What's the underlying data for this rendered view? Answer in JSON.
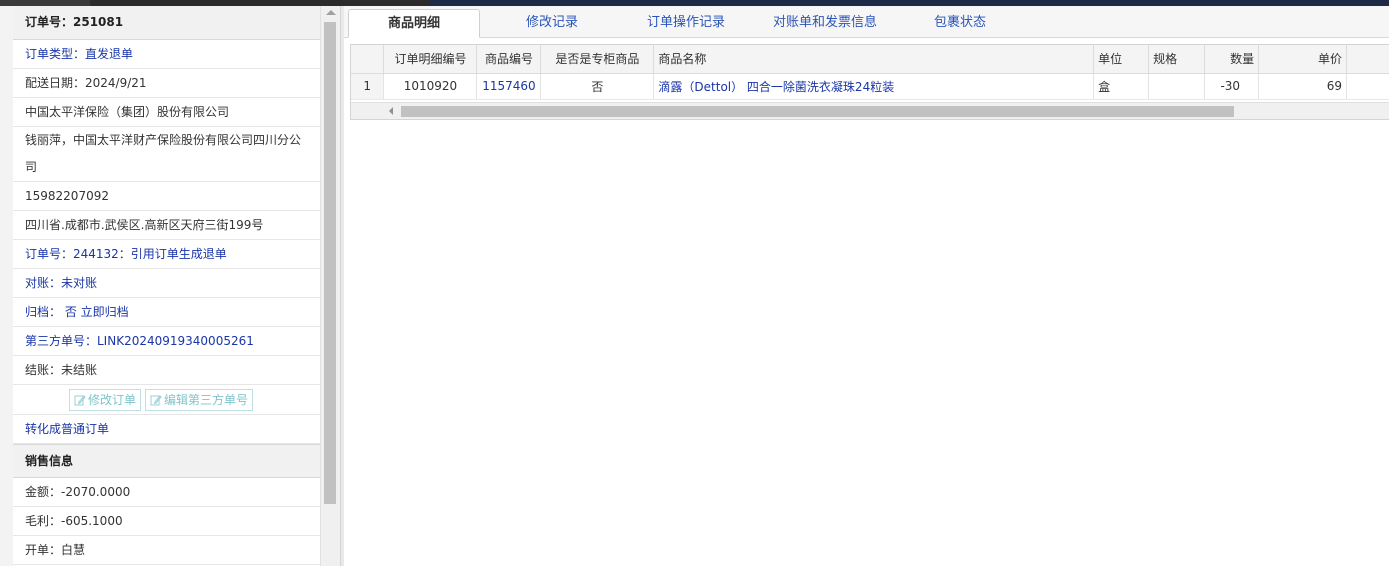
{
  "left": {
    "order_no": "订单号：251081",
    "rows": [
      {
        "text": "订单类型：直发退单",
        "blue": true
      },
      {
        "text": "配送日期：2024/9/21",
        "blue": false
      },
      {
        "text": "中国太平洋保险（集团）股份有限公司",
        "blue": false
      },
      {
        "text": "钱丽萍，中国太平洋财产保险股份有限公司四川分公司",
        "blue": false,
        "wrap": true
      },
      {
        "text": "15982207092",
        "blue": false
      },
      {
        "text": "四川省.成都市.武侯区.高新区天府三街199号",
        "blue": false
      },
      {
        "text": "订单号：244132：引用订单生成退单",
        "blue": true
      },
      {
        "text": "对账：未对账",
        "blue": true
      },
      {
        "text": "归档： 否 立即归档",
        "blue": true
      },
      {
        "text": "第三方单号：LINK20240919340005261",
        "blue": true
      },
      {
        "text": "结账：未结账",
        "blue": false
      }
    ],
    "buttons": {
      "edit_order": "修改订单",
      "edit_third_party": "编辑第三方单号"
    },
    "convert_link": "转化成普通订单",
    "sales_header": "销售信息",
    "sales_rows": [
      {
        "text": "金额：-2070.0000"
      },
      {
        "text": "毛利：-605.1000"
      },
      {
        "text": "开单：白慧"
      }
    ]
  },
  "tabs": [
    {
      "label": "商品明细",
      "active": true
    },
    {
      "label": "修改记录",
      "active": false
    },
    {
      "label": "订单操作记录",
      "active": false
    },
    {
      "label": "对账单和发票信息",
      "active": false
    },
    {
      "label": "包裹状态",
      "active": false
    }
  ],
  "table": {
    "headers": [
      "",
      "订单明细编号",
      "商品编号",
      "是否是专柜商品",
      "商品名称",
      "单位",
      "规格",
      "数量",
      "单价"
    ],
    "rows": [
      [
        "1",
        "1010920",
        "1157460",
        "否",
        "滴露（Dettol） 四合一除菌洗衣凝珠24粒装",
        "盒",
        "",
        "-30",
        "69"
      ]
    ]
  },
  "colors": {
    "link": "#1a36a8",
    "tab_link": "#2a55b8",
    "disabled_button": "#7ec4cc"
  }
}
